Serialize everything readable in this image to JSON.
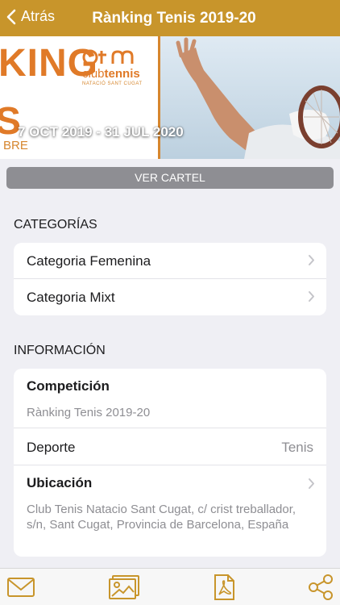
{
  "navbar": {
    "back_label": "Atrás",
    "title": "Rànking Tenis 2019-20",
    "color": "#c8952b"
  },
  "banner": {
    "big_text_1": "KING",
    "big_text_2": "S",
    "small_word": "BRE",
    "logo_text_light": "club",
    "logo_text_bold": "tennis",
    "logo_sub": "NATACIÓ SANT CUGAT",
    "dates": "7 OCT 2019 - 31 JUL 2020"
  },
  "cartel_button": "VER CARTEL",
  "categories": {
    "heading": "CATEGORÍAS",
    "items": [
      {
        "label": "Categoria Femenina"
      },
      {
        "label": "Categoria Mixt"
      }
    ]
  },
  "info": {
    "heading": "INFORMACIÓN",
    "competition_title": "Competición",
    "competition_value": "Rànking Tenis 2019-20",
    "sport_label": "Deporte",
    "sport_value": "Tenis",
    "location_title": "Ubicación",
    "location_value": "Club Tenis Natacio Sant Cugat, c/ crist treballador, s/n, Sant Cugat, Provincia de Barcelona, España"
  },
  "tabbar": {
    "icons": [
      "mail-icon",
      "image-icon",
      "pdf-icon",
      "share-icon"
    ],
    "color": "#c8952b"
  }
}
